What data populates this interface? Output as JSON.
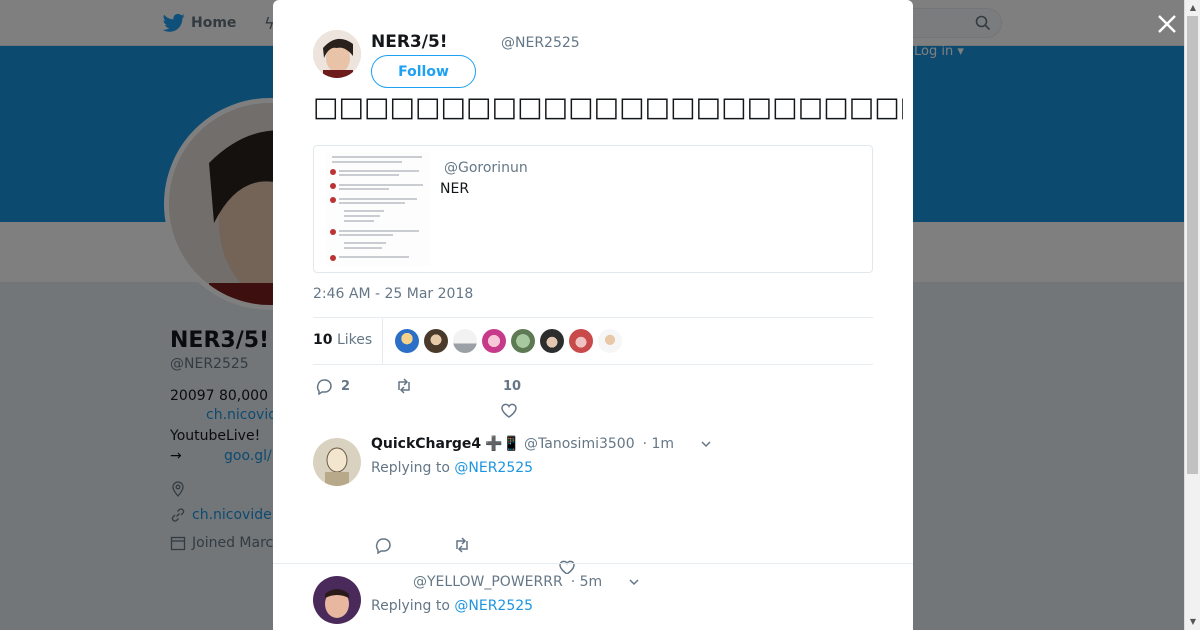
{
  "nav": {
    "home_label": "Home",
    "login_label": "Log in ▾"
  },
  "profile": {
    "name": "NER3/5!",
    "handle": "@NER2525",
    "bio_line1": "20097 80,000",
    "bio_link1": "ch.nicovid",
    "bio_line2": "YoutubeLive!",
    "bio_arrow": "→",
    "bio_link2": "goo.gl/",
    "website": "ch.nicovide",
    "joined": "Joined Marc"
  },
  "tweet": {
    "author_name": "NER3/5!",
    "author_handle": "@NER2525",
    "follow_label": "Follow",
    "text": "□□□□□□□□□□□□□□□□□□□□□□□□□□□□□□□□□□□□□□□□",
    "quote": {
      "handle": "@Gororinun",
      "text": "NER"
    },
    "timestamp": "2:46 AM - 25 Mar 2018",
    "likes_count": "10",
    "likes_label": "Likes",
    "reply_count": "2",
    "like_count": "10"
  },
  "replies": [
    {
      "name": "QuickCharge4",
      "name_emoji": "➕📱",
      "handle": "@Tanosimi3500",
      "time": "· 1m",
      "replying_prefix": "Replying to",
      "replying_to": "@NER2525"
    },
    {
      "name": "",
      "handle": "@YELLOW_POWERRR",
      "time": "· 5m",
      "replying_prefix": "Replying to",
      "replying_to": "@NER2525"
    }
  ],
  "colors": {
    "brand": "#1da1f2",
    "banner": "#1b95e0",
    "link": "#1b95e0"
  }
}
